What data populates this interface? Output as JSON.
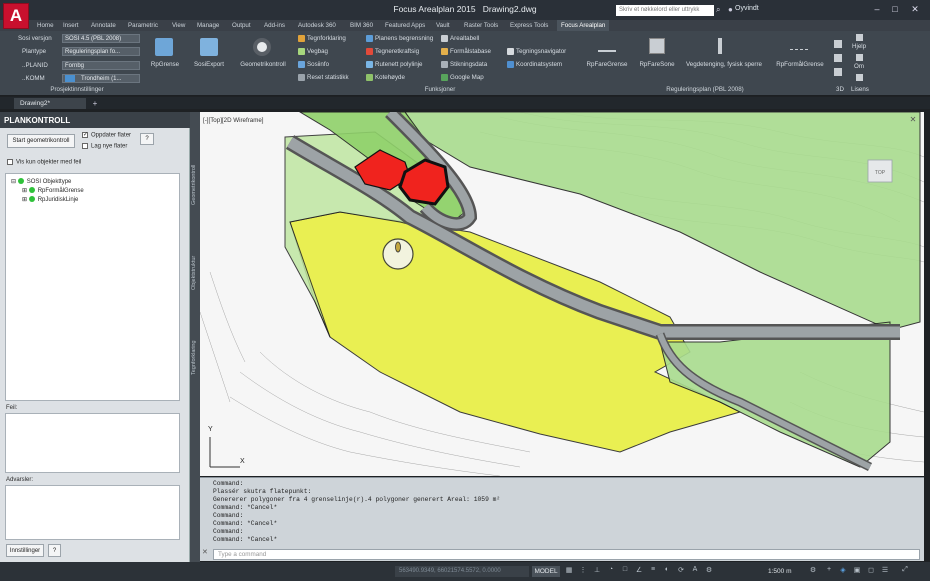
{
  "app": {
    "title": "Focus Arealplan 2015",
    "document": "Drawing2.dwg",
    "logo_letter": "A",
    "search_placeholder": "Skriv et nøkkelord eller uttrykk",
    "user": "Oyvindt"
  },
  "ribbon_tabs": [
    "Home",
    "Insert",
    "Annotate",
    "Parametric",
    "View",
    "Manage",
    "Output",
    "Add-ins",
    "Autodesk 360",
    "BIM 360",
    "Featured Apps",
    "Vault",
    "Raster Tools",
    "Express Tools",
    "Focus Arealplan"
  ],
  "ribbon": {
    "project": {
      "sosi_label": "Sosi versjon",
      "sosi_value": "SOSI 4.5 (PBL 2008)",
      "plantype_label": "Plantype",
      "plantype_value": "Reguleringsplan fo...",
      "planid_label": "..PLANID",
      "planid_value": "Fornbg",
      "komm_label": "..KOMM",
      "komm_value": "Trondheim (1...",
      "group": "Prosjektinnstillinger"
    },
    "big_buttons": [
      "RpGrense",
      "SosiExport",
      "Geometrikontroll"
    ],
    "funksjoner": {
      "col1": [
        "Tegnforklaring",
        "Vegbag",
        "Sosiinfo",
        "Reset statistikk"
      ],
      "col2": [
        "Planens begrensning",
        "Tegneretkraftsig",
        "Rutenett polylinje",
        "Kotehøyde"
      ],
      "col3": [
        "Arealtabell",
        "Formålstabase",
        "Stikningsdata",
        "Google Map"
      ],
      "col4": [
        "Tegningsnavigator",
        "Koordinatsystem"
      ],
      "group": "Funksjoner"
    },
    "regulering": {
      "buttons": [
        "RpFareGrense",
        "RpFareSone",
        "Vegdetenging, fysisk sperre",
        "RpFormålGrense"
      ],
      "group": "Reguleringsplan (PBL 2008)"
    },
    "right": {
      "help": "Hjelp",
      "om": "Om",
      "group_3d": "3D",
      "lisens": "Lisens"
    }
  },
  "doc_tab": "Drawing2*",
  "panel": {
    "title": "PLANKONTROLL",
    "start_button": "Start geometrikontroll",
    "chk_update": "Oppdater flater",
    "chk_new": "Lag nye flater",
    "help_btn": "?",
    "chk_errors_only": "Vis kun objekter med feil",
    "tree": {
      "root": "SOSI Objekttype",
      "children": [
        "RpFormålGrense",
        "RpJuridiskLinje"
      ]
    },
    "errors_label": "Feil:",
    "warnings_label": "Advarsler:",
    "settings_button": "Innstillinger",
    "help_button2": "?"
  },
  "side_strip": [
    "Geometrikontroll",
    "Objektstruktur",
    "Tegnforklaring"
  ],
  "viewport": {
    "label": "[-][Top][2D Wireframe]",
    "axis_x": "X",
    "axis_y": "Y"
  },
  "command_lines": [
    "Command:",
    "Plassér skutra flatepunkt:",
    "Genererer polygoner fra 4 grenselinje(r).4 polygoner generert Areal: 1059 m²",
    "Command: *Cancel*",
    "Command:",
    "Command: *Cancel*",
    "Command:",
    "Command: *Cancel*"
  ],
  "command_input_placeholder": "Type a command",
  "status": {
    "coords": "563490.9349, 66021574.5572, 0.0000",
    "model": "MODEL",
    "scale": "1:500 m"
  },
  "colors": {
    "ribbon": "#3f474f",
    "titlebar": "#2a3038",
    "logo_red": "#c8102e",
    "green_zone": "#a9dc8e",
    "yellow_zone": "#e8ef3c",
    "red_building": "#f0231e",
    "road_grey": "#9da3a6"
  }
}
